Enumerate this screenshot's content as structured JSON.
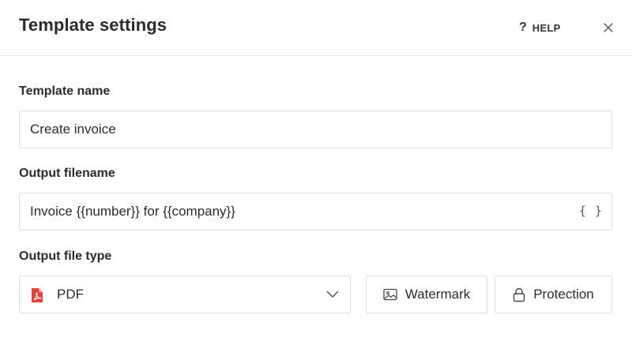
{
  "header": {
    "title": "Template settings",
    "help_icon": "?",
    "help_label": "HELP",
    "close_icon": "close-icon"
  },
  "template_name": {
    "label": "Template name",
    "value": "Create invoice"
  },
  "output_filename": {
    "label": "Output filename",
    "value": "Invoice {{number}} for {{company}}",
    "variables_icon": "{ }"
  },
  "output_file_type": {
    "label": "Output file type",
    "selected": "PDF",
    "icon": "pdf-icon",
    "icon_color": "#e0433a"
  },
  "buttons": {
    "watermark_label": "Watermark",
    "protection_label": "Protection"
  }
}
